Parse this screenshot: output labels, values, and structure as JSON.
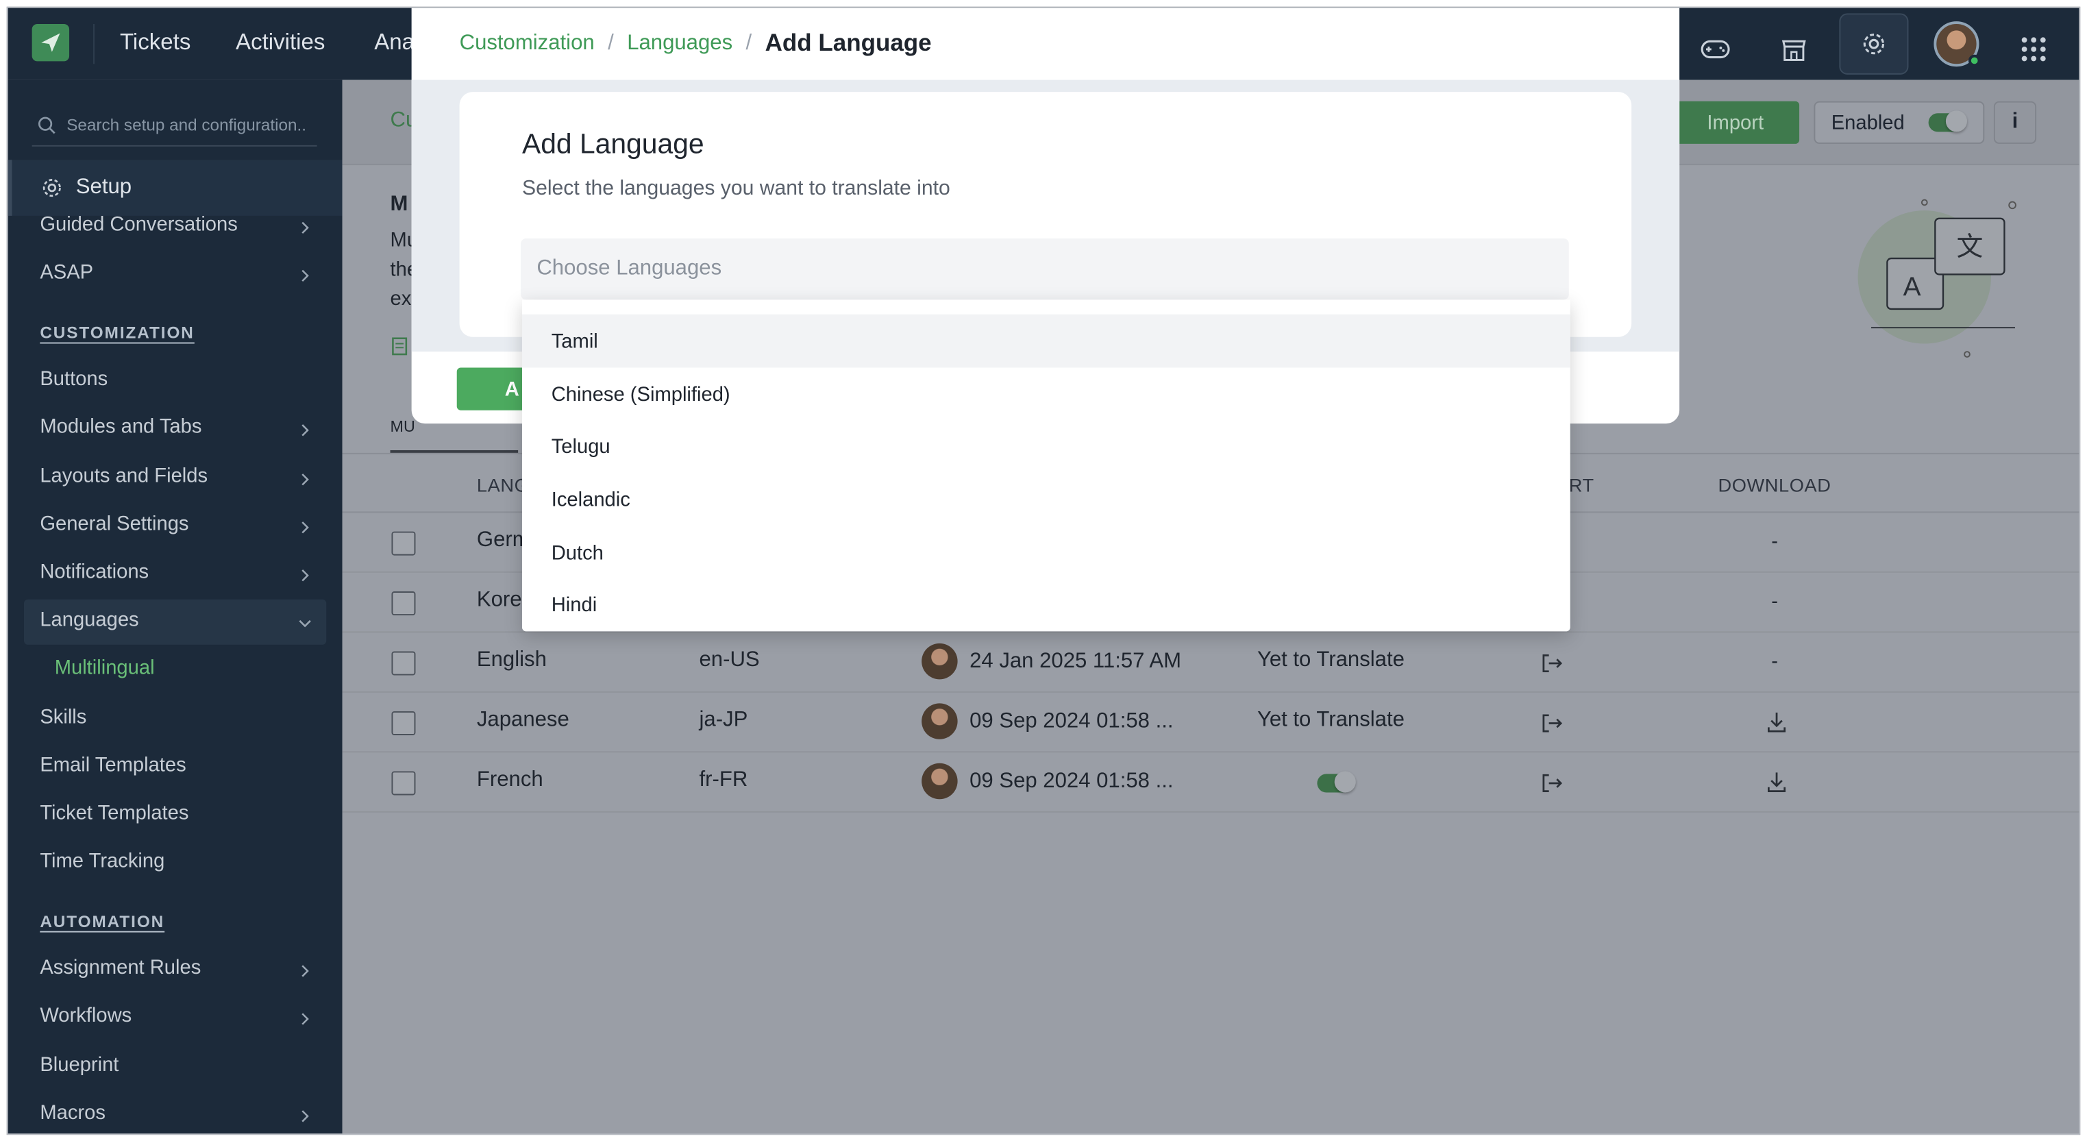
{
  "topbar": {
    "nav": [
      "Tickets",
      "Activities",
      "Ana"
    ],
    "icons": [
      "game-controller-icon",
      "store-icon",
      "settings-gear-icon",
      "user-avatar",
      "apps-grid-icon"
    ]
  },
  "sidebar": {
    "search_placeholder": "Search setup and configuration..",
    "setup_label": "Setup",
    "items_top": [
      {
        "label": "Guided Conversations",
        "chevron": true
      },
      {
        "label": "ASAP",
        "chevron": true
      }
    ],
    "customization_heading": "CUSTOMIZATION",
    "customization_items": [
      {
        "label": "Buttons",
        "chevron": false
      },
      {
        "label": "Modules and Tabs",
        "chevron": true
      },
      {
        "label": "Layouts and Fields",
        "chevron": true
      },
      {
        "label": "General Settings",
        "chevron": true
      },
      {
        "label": "Notifications",
        "chevron": true
      },
      {
        "label": "Languages",
        "chevron": true,
        "expanded": true
      },
      {
        "label": "Multilingual",
        "sub": true
      },
      {
        "label": "Skills"
      },
      {
        "label": "Email Templates"
      },
      {
        "label": "Ticket Templates"
      },
      {
        "label": "Time Tracking"
      }
    ],
    "automation_heading": "AUTOMATION",
    "automation_items": [
      {
        "label": "Assignment Rules",
        "chevron": true
      },
      {
        "label": "Workflows",
        "chevron": true
      },
      {
        "label": "Blueprint",
        "chevron": false
      },
      {
        "label": "Macros",
        "chevron": true
      }
    ]
  },
  "main": {
    "breadcrumb_partial": "Cu",
    "heading_partial": "M",
    "desc_lines": [
      "Mu",
      "the",
      "ex"
    ],
    "tab_partial": "MU",
    "import_label": "Import",
    "enabled_label": "Enabled",
    "enabled_on": true,
    "info_label": "i",
    "table": {
      "headers": {
        "language": "LANG",
        "export": "RT",
        "download": "DOWNLOAD"
      },
      "rows": [
        {
          "language": "Germ",
          "code": "",
          "date": "",
          "status": "",
          "download": "-"
        },
        {
          "language": "Kore",
          "code": "",
          "date": "",
          "status": "",
          "download": "-"
        },
        {
          "language": "English",
          "code": "en-US",
          "date": "24 Jan 2025 11:57 AM",
          "status": "Yet to Translate",
          "download": "-"
        },
        {
          "language": "Japanese",
          "code": "ja-JP",
          "date": "09 Sep 2024 01:58 ...",
          "status": "Yet to Translate",
          "download": "download-icon"
        },
        {
          "language": "French",
          "code": "fr-FR",
          "date": "09 Sep 2024 01:58 ...",
          "status": "toggle-on",
          "download": "download-icon"
        }
      ]
    }
  },
  "modal": {
    "breadcrumb": [
      "Customization",
      "Languages"
    ],
    "breadcrumb_current": "Add Language",
    "title": "Add Language",
    "subtitle": "Select the languages you want to translate into",
    "choose_placeholder": "Choose Languages",
    "add_button_partial": "A",
    "options": [
      "Tamil",
      "Chinese (Simplified)",
      "Telugu",
      "Icelandic",
      "Dutch",
      "Hindi"
    ],
    "highlighted_option": "Tamil"
  },
  "colors": {
    "accent_green": "#3f9a57",
    "sidebar_bg": "#1c2a3a",
    "overlay_bg": "#9a9ea6"
  }
}
